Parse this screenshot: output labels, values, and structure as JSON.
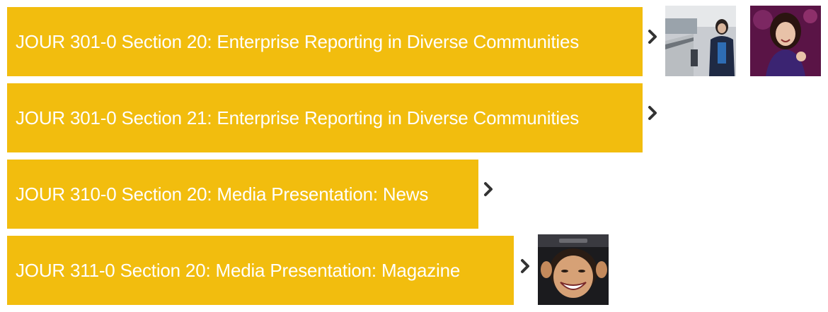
{
  "courses": [
    {
      "label": "JOUR 301-0 Section 20: Enterprise Reporting in Diverse Communities",
      "icon": "chevron-right-icon",
      "thumbnails": [
        "student-photo-bridge",
        "student-photo-purple"
      ]
    },
    {
      "label": "JOUR 301-0 Section 21: Enterprise Reporting in Diverse Communities",
      "icon": "chevron-right-icon",
      "thumbnails": []
    },
    {
      "label": "JOUR 310-0 Section 20: Media Presentation: News",
      "icon": "chevron-right-icon",
      "thumbnails": []
    },
    {
      "label": "JOUR 311-0 Section 20: Media Presentation: Magazine",
      "icon": "chevron-right-icon",
      "thumbnails": [
        "student-photo-smile"
      ]
    }
  ],
  "colors": {
    "course_bg": "#f2bd0e",
    "course_text": "#ffffff",
    "chevron": "#333333"
  }
}
